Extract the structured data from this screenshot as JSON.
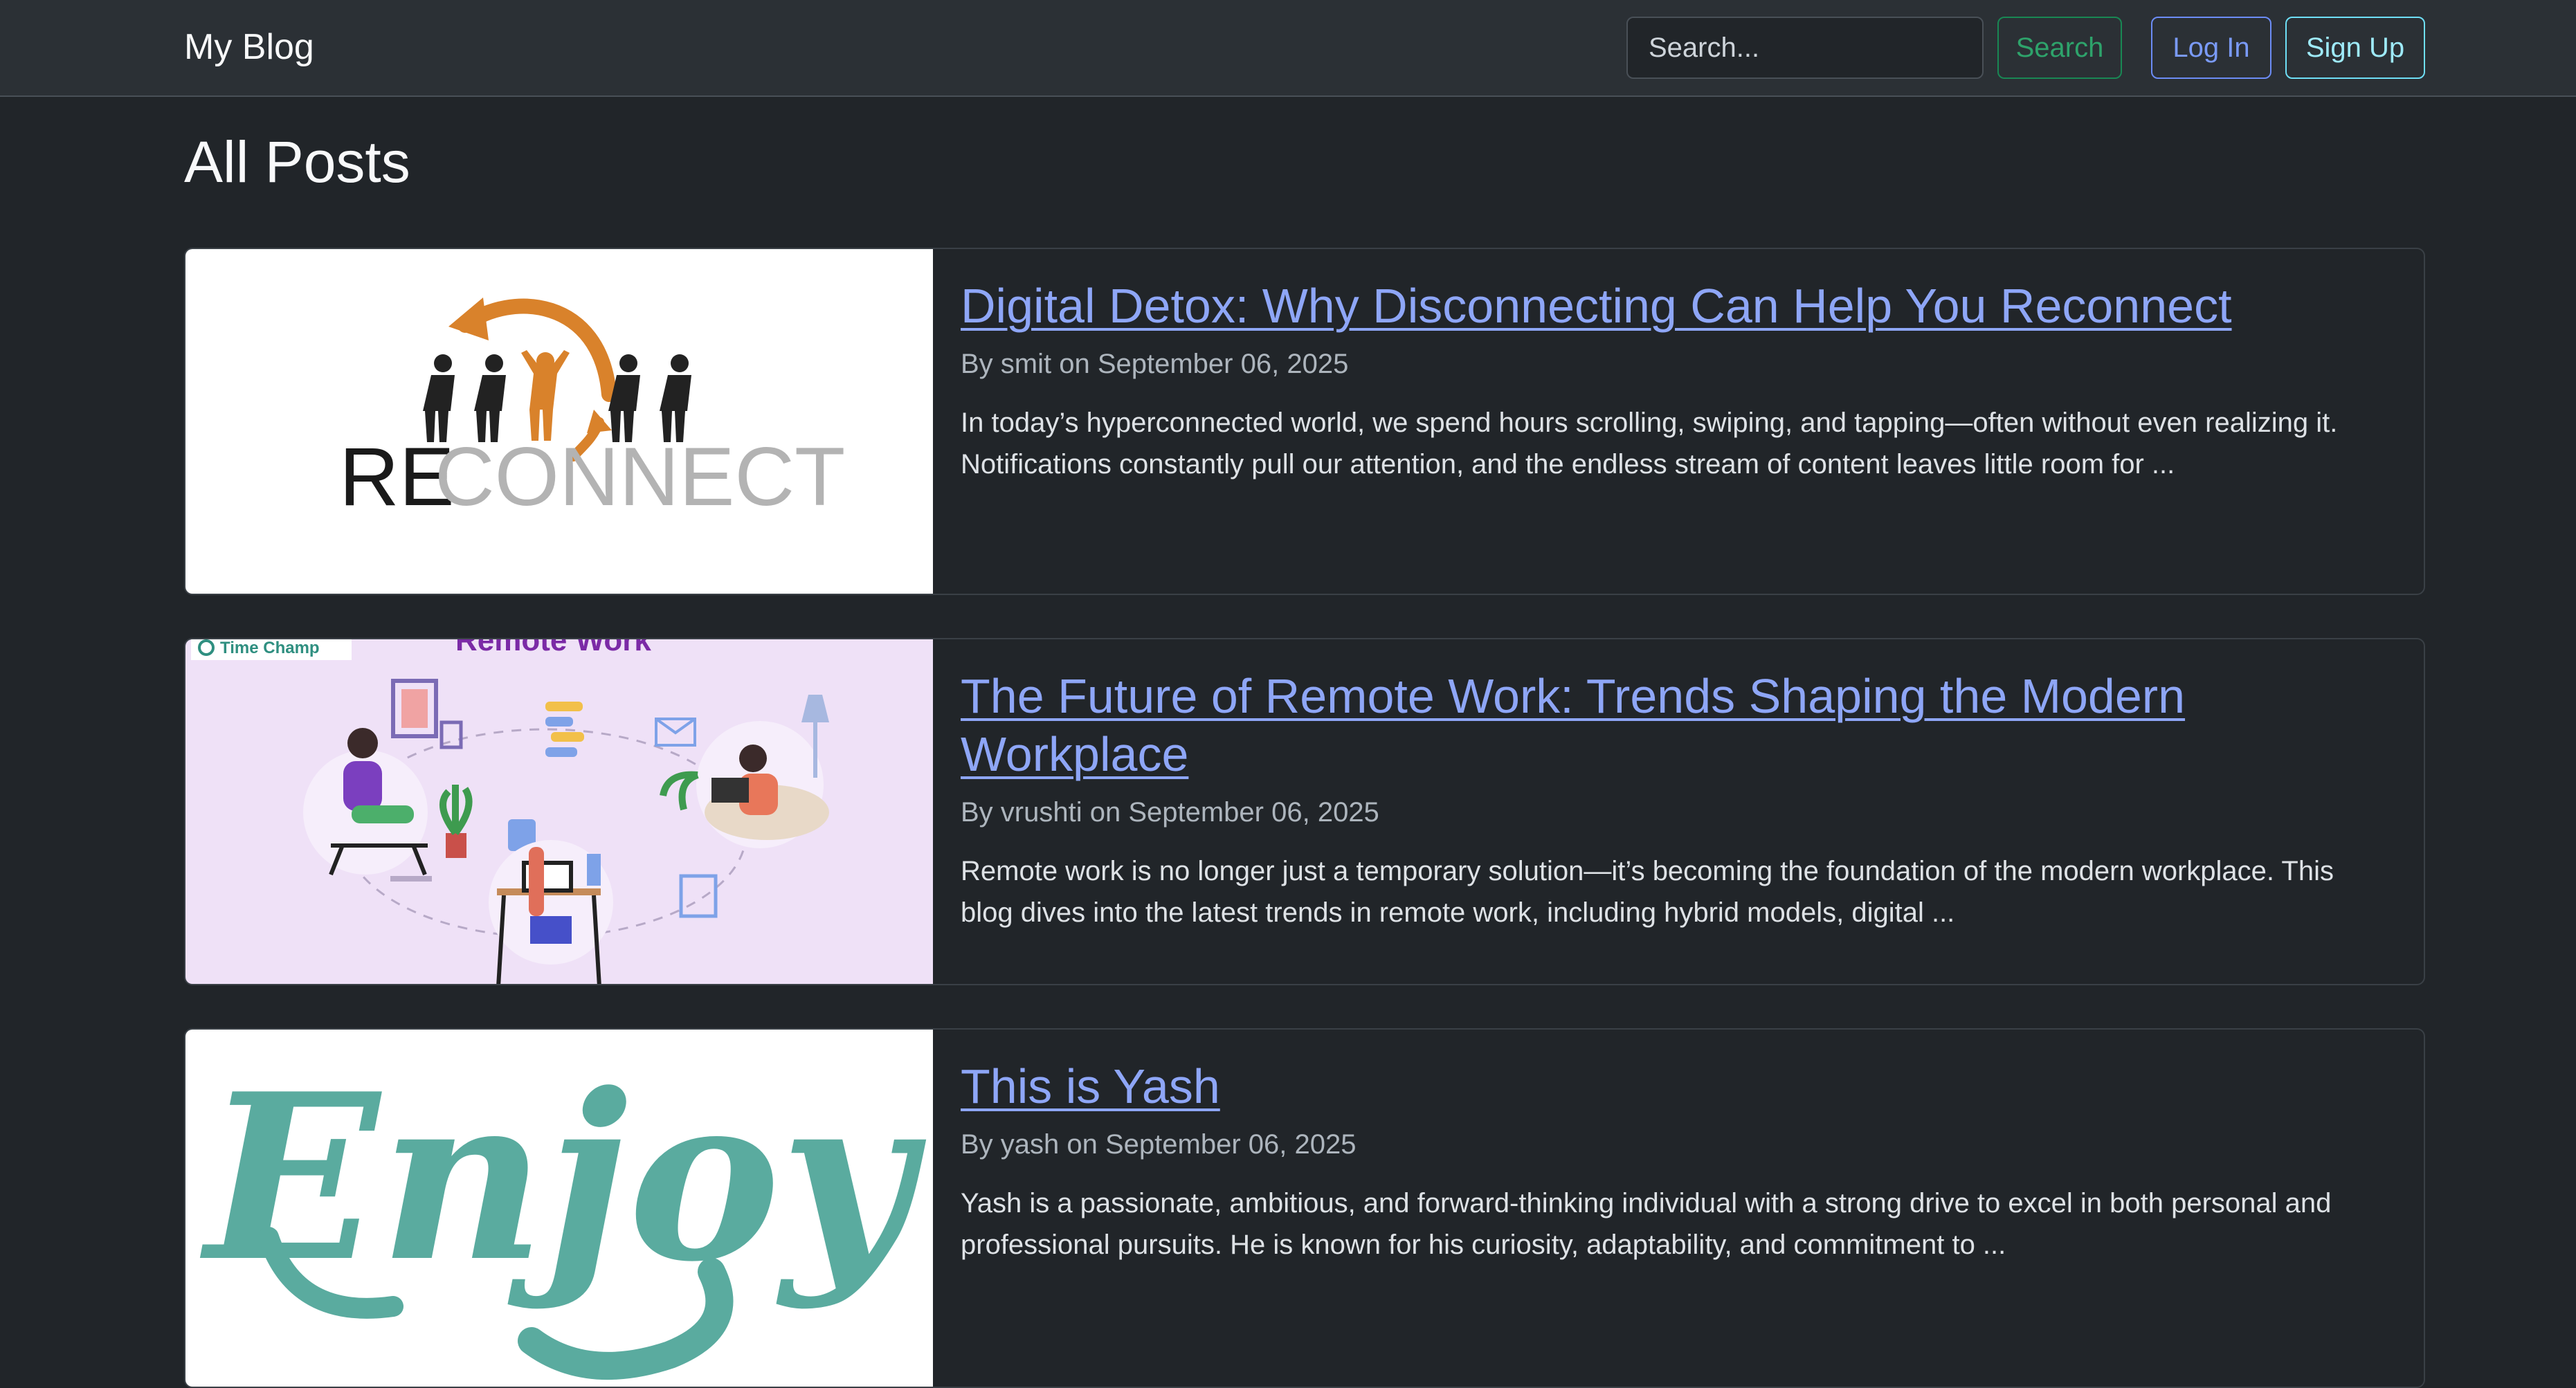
{
  "navbar": {
    "brand": "My Blog",
    "search_placeholder": "Search...",
    "search_button": "Search",
    "login_button": "Log In",
    "signup_button": "Sign Up"
  },
  "main": {
    "heading": "All Posts",
    "posts": [
      {
        "title": "Digital Detox: Why Disconnecting Can Help You Reconnect",
        "meta": "By smit on September 06, 2025",
        "excerpt": "In today’s hyperconnected world, we spend hours scrolling, swiping, and tapping—often without even realizing it. Notifications constantly pull our attention, and the endless stream of content leaves little room for ...",
        "image": {
          "word_dark": "RE",
          "word_light": "CONNECT"
        }
      },
      {
        "title": "The Future of Remote Work: Trends Shaping the Modern Workplace",
        "meta": "By vrushti on September 06, 2025",
        "excerpt": "Remote work is no longer just a temporary solution—it’s becoming the foundation of the modern workplace. This blog dives into the latest trends in remote work, including hybrid models, digital ...",
        "image": {
          "brand": "Time Champ",
          "heading": "Remote Work"
        }
      },
      {
        "title": "This is Yash",
        "meta": "By yash on September 06, 2025",
        "excerpt": "Yash is a passionate, ambitious, and forward-thinking individual with a strong drive to excel in both personal and professional pursuits. He is known for his curiosity, adaptability, and commitment to ...",
        "image": {
          "word": "Enjoy"
        }
      }
    ]
  },
  "colors": {
    "background": "#212529",
    "navbar": "#2b3035",
    "link": "#8ea6f7",
    "search_button": "#198754",
    "login_button": "#6c8cf5",
    "signup_button": "#6edff6",
    "reconnect_orange": "#d9822b",
    "enjoy_teal": "#5aab9f",
    "remote_bg": "#efe1f7"
  }
}
